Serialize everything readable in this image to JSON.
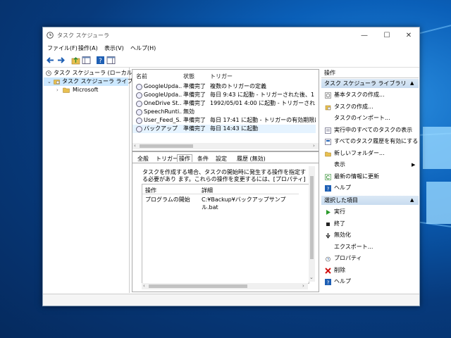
{
  "window": {
    "title": "タスク スケジューラ",
    "minimize": "—",
    "maximize": "☐",
    "close": "✕"
  },
  "menu": [
    "ファイル(F)",
    "操作(A)",
    "表示(V)",
    "ヘルプ(H)"
  ],
  "toolbar": {
    "icons": [
      "back-arrow-icon",
      "forward-arrow-icon",
      "up-folder-icon",
      "show-hide-tree-icon",
      "help-icon",
      "show-pane-icon"
    ]
  },
  "tree": {
    "root": "タスク スケジューラ (ローカル)",
    "library": "タスク スケジューラ ライブラリ",
    "child": "Microsoft"
  },
  "list": {
    "headers": [
      "名前",
      "状態",
      "トリガー"
    ],
    "rows": [
      {
        "name": "GoogleUpda...",
        "status": "準備完了",
        "trigger": "複数のトリガーの定義"
      },
      {
        "name": "GoogleUpda...",
        "status": "準備完了",
        "trigger": "毎日 9:43 に起動 - トリガーされた後、1 日間 の"
      },
      {
        "name": "OneDrive St...",
        "status": "準備完了",
        "trigger": "1992/05/01 4:00 に起動 - トリガーされた後、1.0"
      },
      {
        "name": "SpeechRunti...",
        "status": "無効",
        "trigger": ""
      },
      {
        "name": "User_Feed_S...",
        "status": "準備完了",
        "trigger": "毎日 17:41 に起動 - トリガーの有効期限は 202"
      },
      {
        "name": "バックアップ",
        "status": "準備完了",
        "trigger": "毎日 14:43 に起動"
      }
    ]
  },
  "detail": {
    "tabs": [
      "全般",
      "トリガー",
      "操作",
      "条件",
      "設定",
      "履歴 (無効)"
    ],
    "active_tab": "操作",
    "description": "タスクを作成する場合、タスクの開始時に発生する操作を指定する必要があり ます。これらの操作を変更するには、[プロパティ] コマンドを使って、タスクのプロパティ ページを開いてください。",
    "table_headers": [
      "操作",
      "詳細"
    ],
    "table_rows": [
      {
        "action": "プログラムの開始",
        "detail": "C:¥Backup¥バックアップサンプル.bat"
      }
    ]
  },
  "actions": {
    "header": "操作",
    "section1_title": "タスク スケジューラ ライブラリ",
    "section1_items": [
      {
        "label": "基本タスクの作成...",
        "icon": "create-basic-task-icon"
      },
      {
        "label": "タスクの作成...",
        "icon": "create-task-icon"
      },
      {
        "label": "タスクのインポート...",
        "icon": ""
      },
      {
        "label": "実行中のすべてのタスクの表示",
        "icon": "running-tasks-icon"
      },
      {
        "label": "すべてのタスク履歴を有効にする",
        "icon": "task-history-icon"
      },
      {
        "label": "新しいフォルダー...",
        "icon": "new-folder-icon"
      },
      {
        "label": "表示",
        "icon": "",
        "submenu": "▶"
      },
      {
        "label": "最新の情報に更新",
        "icon": "refresh-icon"
      },
      {
        "label": "ヘルプ",
        "icon": "help-icon"
      }
    ],
    "section2_title": "選択した項目",
    "section2_items": [
      {
        "label": "実行",
        "icon": "run-icon"
      },
      {
        "label": "終了",
        "icon": "stop-icon"
      },
      {
        "label": "無効化",
        "icon": "disable-icon"
      },
      {
        "label": "エクスポート...",
        "icon": ""
      },
      {
        "label": "プロパティ",
        "icon": "properties-icon"
      },
      {
        "label": "削除",
        "icon": "delete-icon"
      },
      {
        "label": "ヘルプ",
        "icon": "help-icon"
      }
    ],
    "collapse_glyph": "▲"
  },
  "colors": {
    "selection": "#cce8ff",
    "action_band": "#c8dcf0",
    "run_green": "#2a9a2a",
    "delete_red": "#d01010",
    "help_blue": "#1e5fb4"
  }
}
